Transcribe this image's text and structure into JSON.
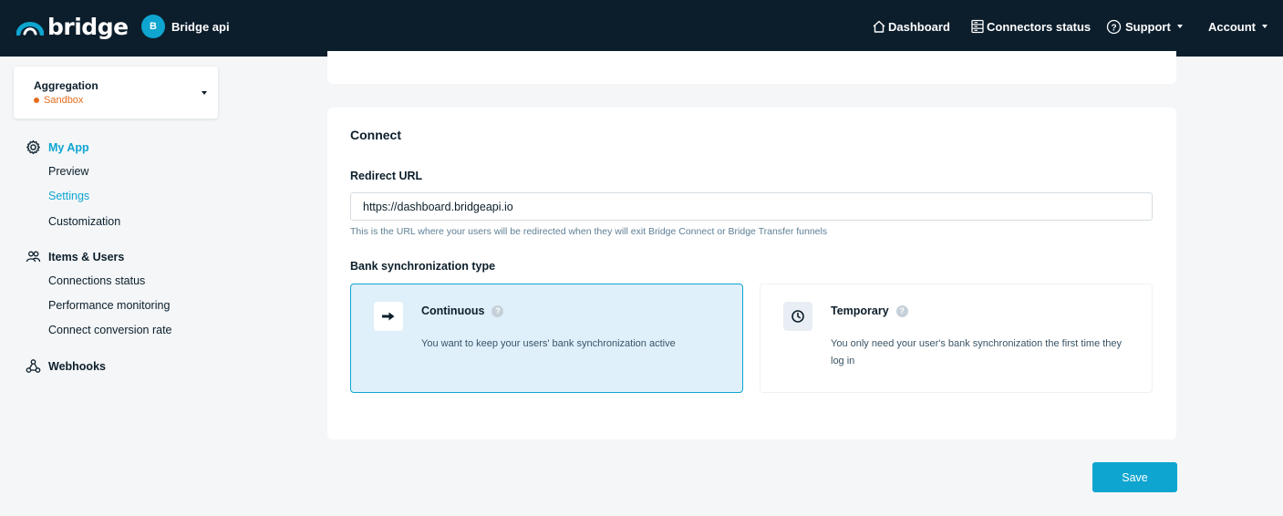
{
  "header": {
    "brand": "bridge",
    "app_initial": "B",
    "app_name": "Bridge api",
    "nav": {
      "dashboard": "Dashboard",
      "connectors_status": "Connectors status",
      "support": "Support",
      "account": "Account"
    }
  },
  "environment": {
    "title": "Aggregation",
    "status": "Sandbox"
  },
  "sidebar": {
    "my_app": {
      "label": "My App",
      "items": [
        "Preview",
        "Settings",
        "Customization"
      ],
      "active_item": "Settings"
    },
    "items_users": {
      "label": "Items & Users",
      "items": [
        "Connections status",
        "Performance monitoring",
        "Connect conversion rate"
      ]
    },
    "webhooks": {
      "label": "Webhooks"
    }
  },
  "connect": {
    "title": "Connect",
    "redirect_label": "Redirect URL",
    "redirect_value": "https://dashboard.bridgeapi.io",
    "redirect_hint": "This is the URL where your users will be redirected when they will exit Bridge Connect or Bridge Transfer funnels",
    "sync_label": "Bank synchronization type",
    "options": [
      {
        "title": "Continuous",
        "description": "You want to keep your users' bank synchronization active",
        "selected": true
      },
      {
        "title": "Temporary",
        "description": "You only need your user's bank synchronization the first time they log in",
        "selected": false
      }
    ]
  },
  "actions": {
    "save": "Save"
  },
  "colors": {
    "accent": "#0ea5d0",
    "topbar": "#0c1e2c",
    "sandbox": "#e56b1a",
    "selected_bg": "#dff0fb"
  }
}
